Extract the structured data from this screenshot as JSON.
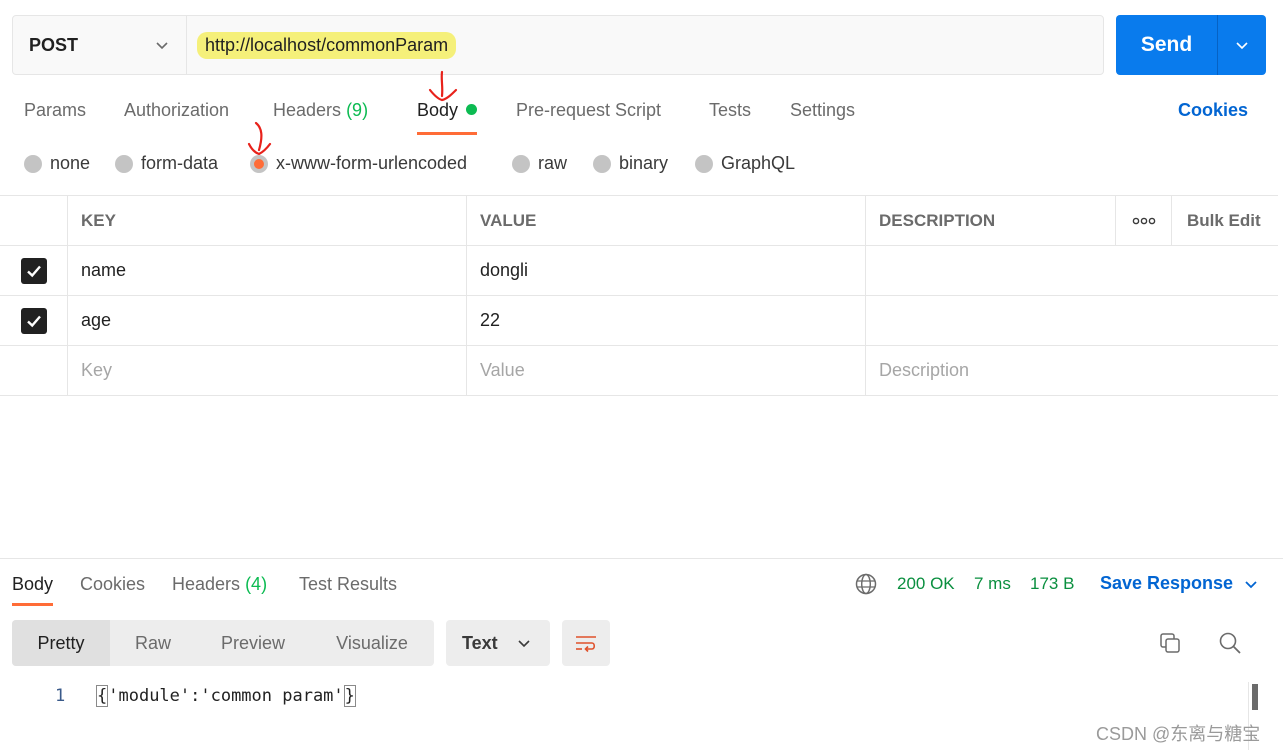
{
  "request": {
    "method": "POST",
    "url": "http://localhost/commonParam",
    "send_label": "Send"
  },
  "tabs": {
    "params": "Params",
    "authorization": "Authorization",
    "headers": "Headers",
    "headers_count": "(9)",
    "body": "Body",
    "prerequest": "Pre-request Script",
    "tests": "Tests",
    "settings": "Settings",
    "cookies": "Cookies"
  },
  "body_types": {
    "none": "none",
    "form_data": "form-data",
    "urlencoded": "x-www-form-urlencoded",
    "raw": "raw",
    "binary": "binary",
    "graphql": "GraphQL",
    "selected": "x-www-form-urlencoded"
  },
  "table": {
    "headers": {
      "key": "KEY",
      "value": "VALUE",
      "description": "DESCRIPTION",
      "bulk_edit": "Bulk Edit"
    },
    "rows": [
      {
        "key": "name",
        "value": "dongli",
        "description": "",
        "checked": true
      },
      {
        "key": "age",
        "value": "22",
        "description": "",
        "checked": true
      }
    ],
    "placeholder": {
      "key": "Key",
      "value": "Value",
      "description": "Description"
    }
  },
  "response": {
    "tabs": {
      "body": "Body",
      "cookies": "Cookies",
      "headers": "Headers",
      "headers_count": "(4)",
      "test_results": "Test Results"
    },
    "status": "200 OK",
    "time": "7 ms",
    "size": "173 B",
    "save_label": "Save Response",
    "views": {
      "pretty": "Pretty",
      "raw": "Raw",
      "preview": "Preview",
      "visualize": "Visualize"
    },
    "format": "Text",
    "lines": [
      {
        "number": "1",
        "open": "{",
        "content": "'module':'common param'",
        "close": "}"
      }
    ]
  },
  "watermark": "CSDN @东离与糖宝",
  "colors": {
    "accent": "#ff6c37",
    "send": "#097bed",
    "link": "#0265d2",
    "success": "#0cbb52",
    "url_highlight": "#f5f07a",
    "annotation": "#e8221b"
  }
}
